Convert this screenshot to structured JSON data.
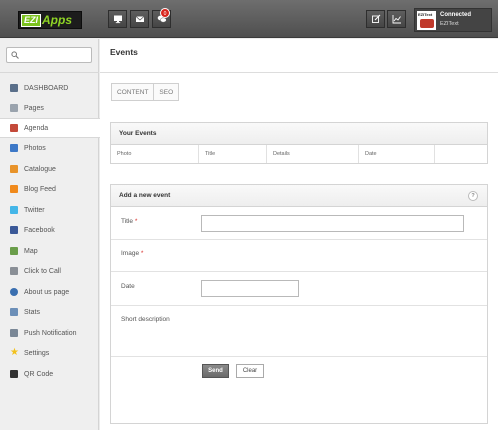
{
  "header": {
    "logo_box": "EZI",
    "logo_word": "Apps",
    "notifications_count": "0",
    "account": {
      "status": "Connected",
      "name": "EZIText",
      "thumb_text": "EZIText"
    }
  },
  "sidebar": {
    "search_placeholder": "",
    "items": [
      {
        "label": "DASHBOARD",
        "icon": "dashboard-icon",
        "color": "#5a6f8a"
      },
      {
        "label": "Pages",
        "icon": "pages-icon",
        "color": "#9aa3ad"
      },
      {
        "label": "Agenda",
        "icon": "agenda-icon",
        "color": "#c44a3a"
      },
      {
        "label": "Photos",
        "icon": "photos-icon",
        "color": "#3d78c7"
      },
      {
        "label": "Catalogue",
        "icon": "catalogue-icon",
        "color": "#e8932a"
      },
      {
        "label": "Blog Feed",
        "icon": "rss-icon",
        "color": "#f08a1c"
      },
      {
        "label": "Twitter",
        "icon": "twitter-icon",
        "color": "#44b6e8"
      },
      {
        "label": "Facebook",
        "icon": "facebook-icon",
        "color": "#3b5998"
      },
      {
        "label": "Map",
        "icon": "map-icon",
        "color": "#6a9d4a"
      },
      {
        "label": "Click to Call",
        "icon": "phone-icon",
        "color": "#8a8f96"
      },
      {
        "label": "About us page",
        "icon": "info-icon",
        "color": "#3a6fb0"
      },
      {
        "label": "Stats",
        "icon": "stats-icon",
        "color": "#6c8fb8"
      },
      {
        "label": "Push Notification",
        "icon": "push-icon",
        "color": "#7a8796"
      },
      {
        "label": "Settings",
        "icon": "star-icon",
        "color": "#f2c11c"
      },
      {
        "label": "QR Code",
        "icon": "qr-icon",
        "color": "#333333"
      }
    ],
    "active_index": 2
  },
  "main": {
    "title": "Events",
    "tabs": [
      "CONTENT",
      "SEO"
    ],
    "events_panel": {
      "title": "Your Events",
      "columns": [
        "Photo",
        "Title",
        "Details",
        "Date",
        ""
      ]
    },
    "form": {
      "title": "Add a new event",
      "help": "?",
      "fields": {
        "title_label": "Title",
        "image_label": "Image",
        "date_label": "Date",
        "description_label": "Short description",
        "required_mark": "*"
      },
      "send_label": "Send",
      "clear_label": "Clear"
    }
  }
}
